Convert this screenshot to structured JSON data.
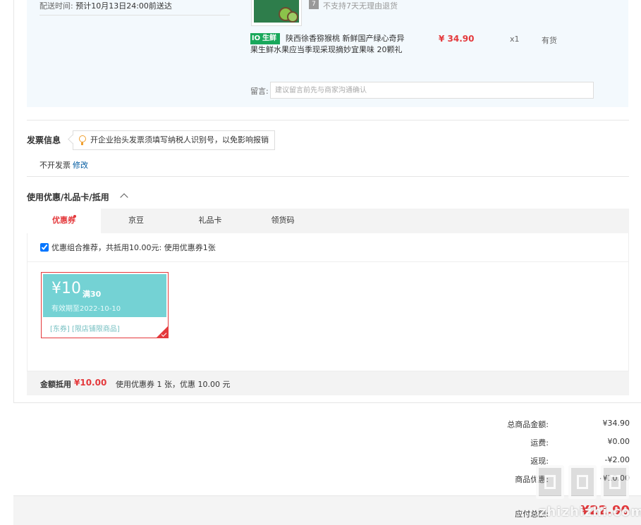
{
  "order": {
    "dispatch_label": "配送时间:",
    "dispatch_value": "预计10月13日24:00前送达",
    "return_icon": "7",
    "return_policy": "不支持7天无理由退货",
    "fresh_tag_icon": "IO",
    "fresh_tag_text": "生鲜",
    "product_name": "陕西徐香猕猴桃 新鲜国产绿心奇异果生鲜水果应当季现采现摘妙宜果味 20颗礼",
    "price": "¥ 34.90",
    "quantity": "x1",
    "stock": "有货",
    "message_label": "留言:",
    "message_placeholder": "建议留言前先与商家沟通确认"
  },
  "invoice": {
    "title": "发票信息",
    "tip": "开企业抬头发票须填写纳税人识别号，以免影响报销",
    "status": "不开发票",
    "modify_link": "修改"
  },
  "coupons": {
    "title": "使用优惠/礼品卡/抵用",
    "tabs": [
      {
        "label": "优惠券",
        "active": true
      },
      {
        "label": "京豆",
        "active": false
      },
      {
        "label": "礼品卡",
        "active": false
      },
      {
        "label": "领货码",
        "active": false
      }
    ],
    "recommend_checked": true,
    "recommend_text": "优惠组合推荐，共抵用10.00元: 使用优惠券1张",
    "card": {
      "amount": "¥10",
      "threshold": "满30",
      "valid_until": "有效期至2022-10-10",
      "tags": "[东券]  [限店铺限商品]",
      "color": "#74d2d4"
    },
    "deduct_label": "金额抵用",
    "deduct_amount": "¥10.00",
    "deduct_desc": "使用优惠券 1 张，优惠 10.00 元"
  },
  "summary": {
    "rows": [
      {
        "label": "总商品金额:",
        "value": "¥34.90"
      },
      {
        "label": "运费:",
        "value": "¥0.00"
      },
      {
        "label": "返现:",
        "value": "-¥2.00"
      },
      {
        "label": "商品优惠:",
        "value": "-¥10.00"
      }
    ],
    "total_label": "应付总额:",
    "total_value": "¥22.90"
  },
  "watermark": {
    "text": "zhizhizhi.com"
  },
  "colors": {
    "accent": "#e4393c",
    "link": "#005aa0",
    "fresh": "#19a85b",
    "panel_bg": "#f3f9fd"
  }
}
